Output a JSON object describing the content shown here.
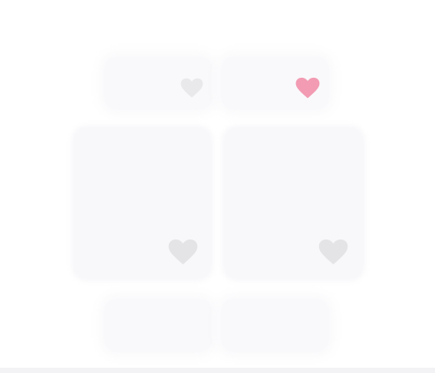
{
  "colors": {
    "background": "#ffffff",
    "card": "#f8f8fa",
    "heart_liked": "#f29bb2",
    "heart_unliked": "#e4e4e6"
  },
  "cards": [
    {
      "icon": "heart-icon",
      "liked": false
    },
    {
      "icon": "heart-icon",
      "liked": true
    },
    {
      "icon": "heart-icon",
      "liked": false
    },
    {
      "icon": "heart-icon",
      "liked": false
    },
    {
      "icon": null,
      "liked": null
    },
    {
      "icon": null,
      "liked": null
    }
  ]
}
